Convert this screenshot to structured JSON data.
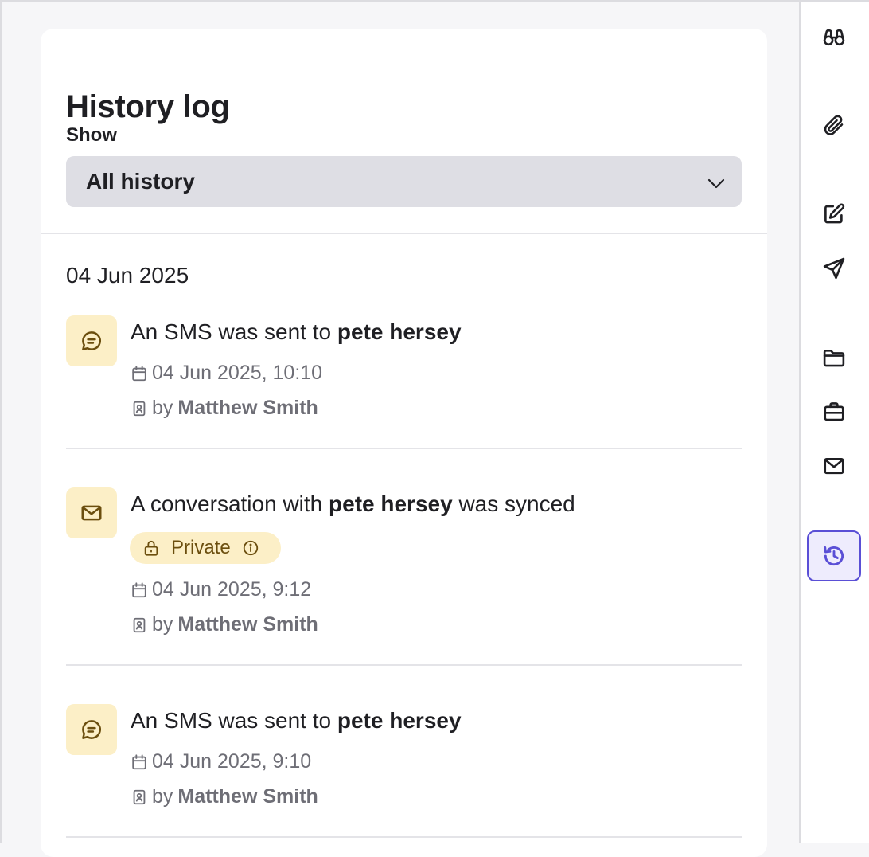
{
  "panel": {
    "title": "History log",
    "filter_label": "Show",
    "filter_value": "All history"
  },
  "timeline": {
    "date_heading": "04 Jun 2025",
    "entries": [
      {
        "type": "sms",
        "icon": "chat-bubble-icon",
        "text_prefix": "An SMS was sent to ",
        "contact": "pete hersey",
        "text_suffix": "",
        "timestamp": "04 Jun 2025, 10:10",
        "by_label": "by",
        "author": "Matthew Smith"
      },
      {
        "type": "email",
        "icon": "envelope-icon",
        "text_prefix": "A conversation with ",
        "contact": "pete hersey",
        "text_suffix": " was synced",
        "badge": "Private",
        "timestamp": "04 Jun 2025, 9:12",
        "by_label": "by",
        "author": "Matthew Smith"
      },
      {
        "type": "sms",
        "icon": "chat-bubble-icon",
        "text_prefix": "An SMS was sent to ",
        "contact": "pete hersey",
        "text_suffix": "",
        "timestamp": "04 Jun 2025, 9:10",
        "by_label": "by",
        "author": "Matthew Smith"
      }
    ]
  },
  "rail": {
    "items": [
      {
        "icon": "binoculars-icon"
      },
      {
        "icon": "paperclip-icon"
      },
      {
        "icon": "edit-icon"
      },
      {
        "icon": "send-icon"
      },
      {
        "icon": "folder-icon"
      },
      {
        "icon": "briefcase-icon"
      },
      {
        "icon": "mail-icon"
      },
      {
        "icon": "history-icon",
        "active": true
      }
    ]
  },
  "colors": {
    "accent": "#5a4fd6",
    "entry_icon_bg": "#fcefc7",
    "entry_icon_fg": "#6b4e0e",
    "select_bg": "#dedee4"
  }
}
